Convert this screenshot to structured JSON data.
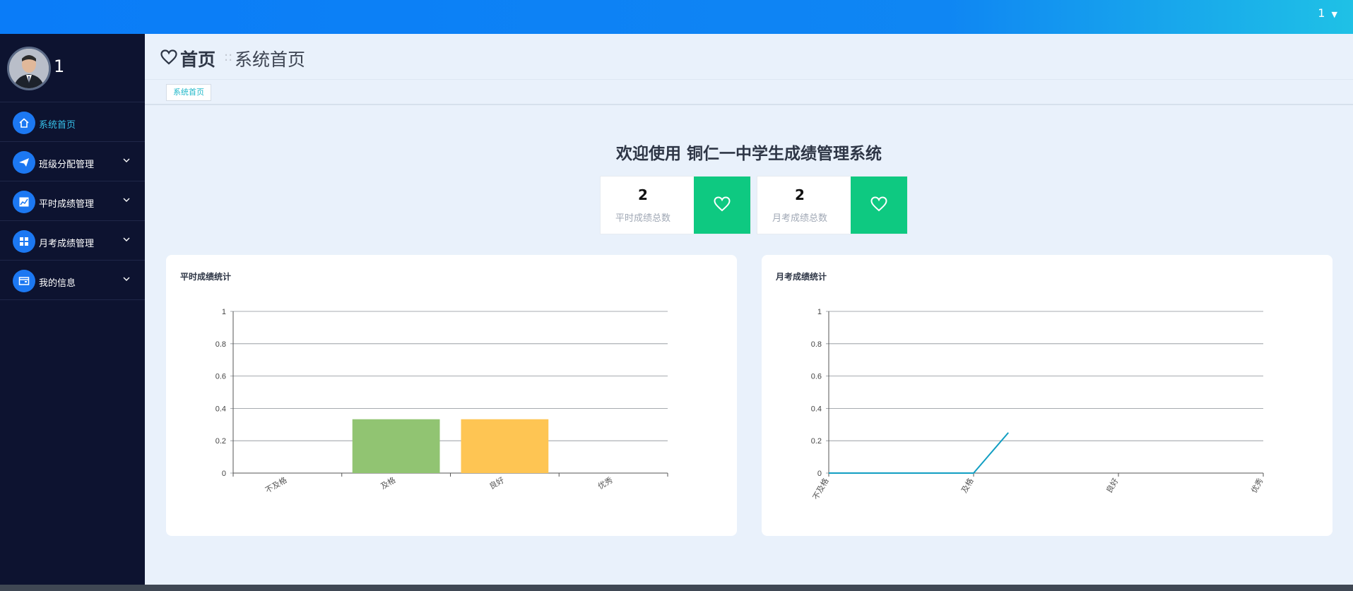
{
  "topbar": {
    "user_label": "1"
  },
  "sidebar": {
    "username": "1",
    "items": [
      {
        "label": "系统首页",
        "icon": "home-icon",
        "active": true,
        "expandable": false
      },
      {
        "label": "班级分配管理",
        "icon": "paper-plane-icon",
        "active": false,
        "expandable": true
      },
      {
        "label": "平时成绩管理",
        "icon": "line-chart-icon",
        "active": false,
        "expandable": true
      },
      {
        "label": "月考成绩管理",
        "icon": "grid-icon",
        "active": false,
        "expandable": true
      },
      {
        "label": "我的信息",
        "icon": "wallet-icon",
        "active": false,
        "expandable": true
      }
    ]
  },
  "header": {
    "home": "首页",
    "separator": "::",
    "subtitle": "系统首页"
  },
  "tabs": [
    {
      "label": "系统首页"
    }
  ],
  "welcome": "欢迎使用 铜仁一中学生成绩管理系统",
  "stats": [
    {
      "value": "2",
      "label": "平时成绩总数"
    },
    {
      "value": "2",
      "label": "月考成绩总数"
    }
  ],
  "colors": {
    "accent": "#0ec981",
    "primary": "#1c78f2",
    "bar_pass": "#91c472",
    "bar_good": "#fec553",
    "line": "#119ec2"
  },
  "chart_data": [
    {
      "type": "bar",
      "title": "平时成绩统计",
      "categories": [
        "不及格",
        "及格",
        "良好",
        "优秀"
      ],
      "values": [
        0,
        0.333,
        0.333,
        0
      ],
      "ylim": [
        0,
        1
      ],
      "yticks": [
        "0",
        "0.2",
        "0.4",
        "0.6",
        "0.8",
        "1"
      ],
      "grid": true
    },
    {
      "type": "line",
      "title": "月考成绩统计",
      "categories": [
        "不及格",
        "及格",
        "良好",
        "优秀"
      ],
      "values": [
        0,
        0,
        0.25
      ],
      "ylim": [
        0,
        1
      ],
      "yticks": [
        "0",
        "0.2",
        "0.4",
        "0.6",
        "0.8",
        "1"
      ],
      "grid": true
    }
  ]
}
